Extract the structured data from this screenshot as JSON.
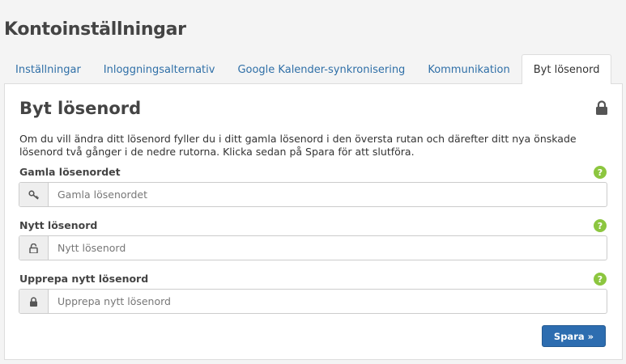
{
  "page_title": "Kontoinställningar",
  "tabs": [
    {
      "label": "Inställningar"
    },
    {
      "label": "Inloggningsalternativ"
    },
    {
      "label": "Google Kalender-synkronisering"
    },
    {
      "label": "Kommunikation"
    },
    {
      "label": "Byt lösenord"
    }
  ],
  "active_tab": "Byt lösenord",
  "panel": {
    "title": "Byt lösenord",
    "header_icon": "lock-icon",
    "description": "Om du vill ändra ditt lösenord fyller du i ditt gamla lösenord i den översta rutan och därefter ditt nya önskade lösenord två gånger i de nedre rutorna. Klicka sedan på Spara för att slutföra.",
    "fields": [
      {
        "label": "Gamla lösenordet",
        "placeholder": "Gamla lösenordet",
        "value": "",
        "icon": "key-icon"
      },
      {
        "label": "Nytt lösenord",
        "placeholder": "Nytt lösenord",
        "value": "",
        "icon": "unlock-icon"
      },
      {
        "label": "Upprepa nytt lösenord",
        "placeholder": "Upprepa nytt lösenord",
        "value": "",
        "icon": "lock-icon"
      }
    ],
    "help_symbol": "?",
    "save_label": "Spara »"
  },
  "colors": {
    "accent": "#2d6db0",
    "tab_link": "#2f6fa7",
    "help": "#8cc63f"
  }
}
